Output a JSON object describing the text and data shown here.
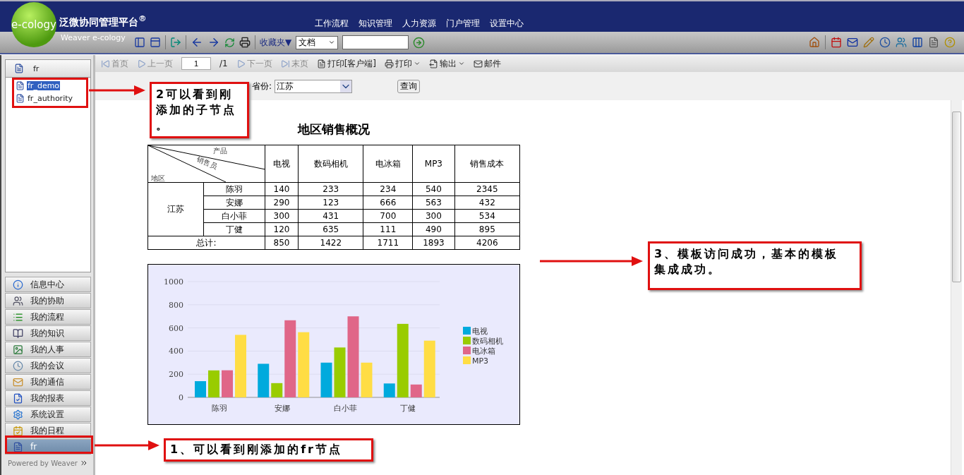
{
  "header": {
    "logo": "e-cology",
    "brand": "泛微协同管理平台",
    "registered": "®",
    "tagline": "Weaver e-cology",
    "nav": [
      "工作流程",
      "知识管理",
      "人力资源",
      "门户管理",
      "设置中心"
    ]
  },
  "toolbar": {
    "favorites": "收藏夹▼",
    "search_type": "文档"
  },
  "tree": {
    "root": "fr",
    "children": [
      {
        "label": "fr_demo",
        "selected": true
      },
      {
        "label": "fr_authority",
        "selected": false
      }
    ]
  },
  "menu": [
    {
      "label": "信息中心",
      "selected": false
    },
    {
      "label": "我的协助",
      "selected": false
    },
    {
      "label": "我的流程",
      "selected": false
    },
    {
      "label": "我的知识",
      "selected": false
    },
    {
      "label": "我的人事",
      "selected": false
    },
    {
      "label": "我的会议",
      "selected": false
    },
    {
      "label": "我的通信",
      "selected": false
    },
    {
      "label": "我的报表",
      "selected": false
    },
    {
      "label": "系统设置",
      "selected": false
    },
    {
      "label": "我的日程",
      "selected": false
    },
    {
      "label": "fr",
      "selected": true
    }
  ],
  "footer": "Powered by Weaver",
  "report_toolbar": [
    {
      "kind": "button",
      "label": "首页",
      "disabled": true
    },
    {
      "kind": "button",
      "label": "上一页",
      "disabled": true
    },
    {
      "kind": "page",
      "value": "1"
    },
    {
      "kind": "text",
      "label": "/1"
    },
    {
      "kind": "button",
      "label": "下一页",
      "disabled": true
    },
    {
      "kind": "button",
      "label": "末页",
      "disabled": true
    },
    {
      "kind": "button",
      "label": "打印[客户端]",
      "disabled": false
    },
    {
      "kind": "menu",
      "label": "打印",
      "disabled": false
    },
    {
      "kind": "menu",
      "label": "输出",
      "disabled": false
    },
    {
      "kind": "button",
      "label": "邮件",
      "disabled": false
    }
  ],
  "params": {
    "label": "省份:",
    "province": "江苏",
    "query": "查询"
  },
  "report": {
    "title": "地区销售概况",
    "corner": {
      "top": "产品",
      "middle": "销售员",
      "bottom": "地区"
    },
    "columns": [
      "电视",
      "数码相机",
      "电冰箱",
      "MP3",
      "销售成本"
    ],
    "region": "江苏",
    "rows": [
      {
        "name": "陈羽",
        "values": [
          "140",
          "233",
          "234",
          "540",
          "2345"
        ]
      },
      {
        "name": "安娜",
        "values": [
          "290",
          "123",
          "666",
          "563",
          "432"
        ]
      },
      {
        "name": "白小菲",
        "values": [
          "300",
          "431",
          "700",
          "300",
          "534"
        ]
      },
      {
        "name": "丁健",
        "values": [
          "120",
          "635",
          "111",
          "490",
          "895"
        ]
      }
    ],
    "total": {
      "label": "总计:",
      "values": [
        "850",
        "1422",
        "1711",
        "1893",
        "4206"
      ]
    }
  },
  "chart": {
    "chart_data": {
      "type": "bar",
      "categories": [
        "陈羽",
        "安娜",
        "白小菲",
        "丁健"
      ],
      "series": [
        {
          "name": "电视",
          "color": "#00aadd",
          "values": [
            140,
            290,
            300,
            120
          ]
        },
        {
          "name": "数码相机",
          "color": "#99cc00",
          "values": [
            233,
            123,
            431,
            635
          ]
        },
        {
          "name": "电冰箱",
          "color": "#e06688",
          "values": [
            234,
            666,
            700,
            111
          ]
        },
        {
          "name": "MP3",
          "color": "#ffdd44",
          "values": [
            540,
            563,
            300,
            490
          ]
        }
      ],
      "ylim": [
        0,
        1000
      ],
      "yticks": [
        0,
        200,
        400,
        600,
        800,
        1000
      ],
      "grid": true,
      "legend": true
    }
  },
  "annotations": [
    {
      "text": "2可以看到刚添加的子节点。"
    },
    {
      "text": "3、模板访问成功，基本的模板集成成功。"
    },
    {
      "text": "1、可以看到刚添加的fr节点"
    }
  ]
}
